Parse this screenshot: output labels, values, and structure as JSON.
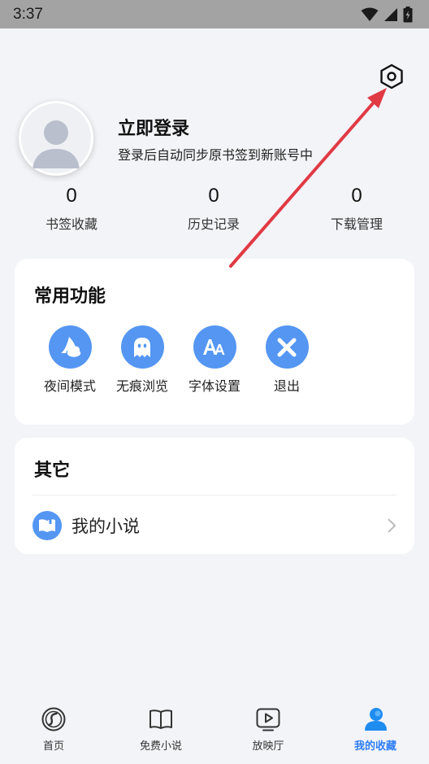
{
  "status_bar": {
    "time": "3:37"
  },
  "profile": {
    "login_title": "立即登录",
    "login_subtitle": "登录后自动同步原书签到新账号中"
  },
  "stats": [
    {
      "value": "0",
      "label": "书签收藏"
    },
    {
      "value": "0",
      "label": "历史记录"
    },
    {
      "value": "0",
      "label": "下载管理"
    }
  ],
  "common": {
    "title": "常用功能",
    "items": [
      {
        "label": "夜间模式",
        "icon": "night-mode-icon"
      },
      {
        "label": "无痕浏览",
        "icon": "ghost-icon"
      },
      {
        "label": "字体设置",
        "icon": "font-icon"
      },
      {
        "label": "退出",
        "icon": "close-icon"
      }
    ]
  },
  "other": {
    "title": "其它",
    "items": [
      {
        "label": "我的小说",
        "icon": "book-icon"
      }
    ]
  },
  "nav": {
    "items": [
      {
        "label": "首页",
        "icon": "home-icon",
        "active": false
      },
      {
        "label": "免费小说",
        "icon": "open-book-icon",
        "active": false
      },
      {
        "label": "放映厅",
        "icon": "play-icon",
        "active": false
      },
      {
        "label": "我的收藏",
        "icon": "user-icon",
        "active": true
      }
    ]
  },
  "colors": {
    "accent": "#5496f2",
    "active_nav": "#2f7ef5",
    "background": "#f3f4f8",
    "annotation_arrow": "#e03a44"
  }
}
